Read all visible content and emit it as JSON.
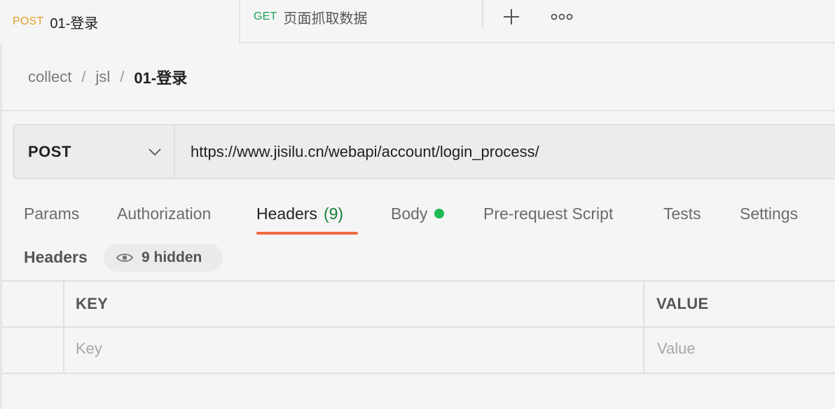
{
  "tabs": [
    {
      "method": "POST",
      "title": "01-登录",
      "active": true
    },
    {
      "method": "GET",
      "title": "页面抓取数据",
      "active": false
    }
  ],
  "tab_actions": {
    "new_tab_icon": "plus-icon",
    "more_icon": "more-horizontal-icon"
  },
  "breadcrumb": {
    "items": [
      "collect",
      "jsl"
    ],
    "separator": "/",
    "current": "01-登录"
  },
  "request": {
    "method": "POST",
    "url": "https://www.jisilu.cn/webapi/account/login_process/"
  },
  "request_tabs": [
    {
      "label": "Params"
    },
    {
      "label": "Authorization"
    },
    {
      "label": "Headers",
      "count": "(9)",
      "active": true
    },
    {
      "label": "Body",
      "has_content_dot": true
    },
    {
      "label": "Pre-request Script"
    },
    {
      "label": "Tests"
    },
    {
      "label": "Settings"
    }
  ],
  "headers_section": {
    "label": "Headers",
    "hidden_toggle": "9 hidden",
    "columns": {
      "key": "KEY",
      "value": "VALUE"
    },
    "placeholders": {
      "key": "Key",
      "value": "Value"
    }
  },
  "colors": {
    "accent_orange": "#ef6a3f",
    "post_method": "#e0a12a",
    "get_method": "#1aa053",
    "count_green": "#1a7f37",
    "status_dot": "#1db954"
  }
}
